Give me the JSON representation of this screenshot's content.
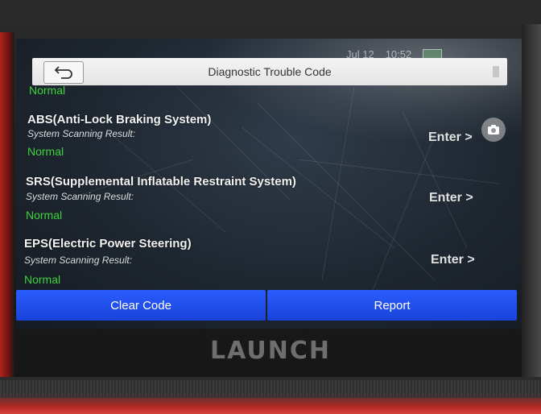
{
  "status_bar": {
    "date": "Jul 12",
    "time": "10:52"
  },
  "header": {
    "back_icon": "back-arrow-icon",
    "title": "Diagnostic Trouble Code"
  },
  "list": {
    "partial_item": {
      "status": "Normal"
    },
    "items": [
      {
        "name": "ABS(Anti-Lock Braking System)",
        "result_label": "System Scanning Result:",
        "status": "Normal",
        "enter_label": "Enter >"
      },
      {
        "name": "SRS(Supplemental Inflatable Restraint System)",
        "result_label": "System Scanning Result:",
        "status": "Normal",
        "enter_label": "Enter >"
      },
      {
        "name": "EPS(Electric Power Steering)",
        "result_label": "System Scanning Result:",
        "status": "Normal",
        "enter_label": "Enter >"
      }
    ]
  },
  "floating": {
    "camera_icon": "camera-icon"
  },
  "actions": {
    "clear_code": "Clear Code",
    "report": "Report"
  },
  "device": {
    "brand": "LAUNCH"
  },
  "colors": {
    "button_blue": "#1f4ef0",
    "normal_green": "#3ed23e",
    "title_bar": "#ececec"
  }
}
